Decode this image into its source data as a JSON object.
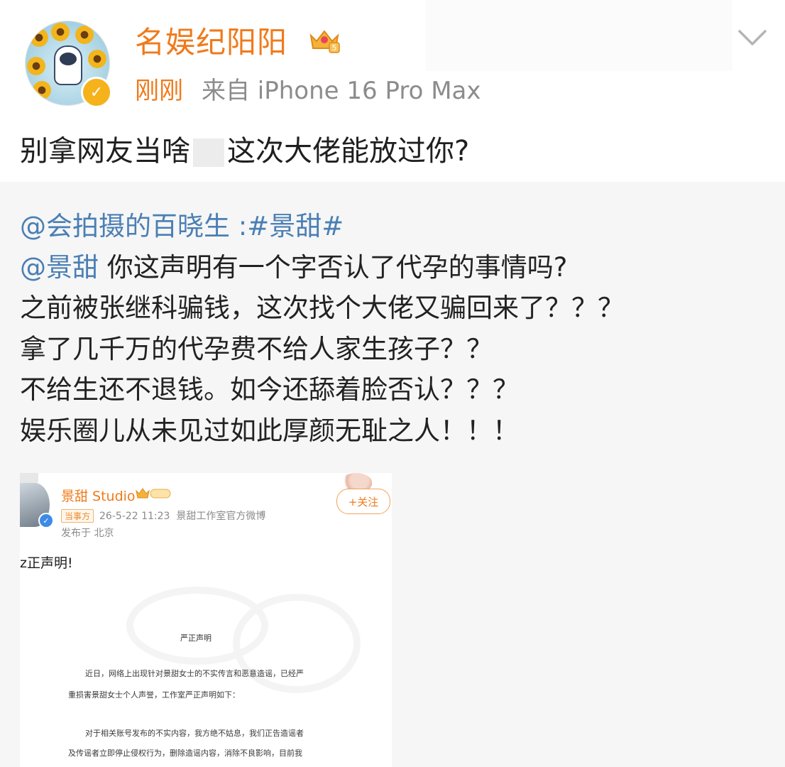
{
  "header": {
    "username": "名娱纪阳阳",
    "time": "刚刚",
    "device": "来自 iPhone 16 Pro Max",
    "verified_badge": "✓",
    "crown_level": "5"
  },
  "post": {
    "text_before": "别拿网友当啥",
    "text_after": "这次大佬能放过你?"
  },
  "repost": {
    "line1_mention": "@会拍摄的百晓生",
    "line1_rest": " :#景甜#",
    "line2_mention": "@景甜",
    "line2_rest": " 你这声明有一个字否认了代孕的事情吗?",
    "line3": "之前被张继科骗钱，这次找个大佬又骗回来了？？？",
    "line4": "拿了几千万的代孕费不给人家生孩子？？",
    "line5": "不给生还不退钱。如今还舔着脸否认？？？",
    "line6": "娱乐圈儿从未见过如此厚颜无耻之人！！！"
  },
  "embed": {
    "name": "景甜 Studio",
    "tag": "当事方",
    "date": "26-5-22 11:23",
    "source": "景甜工作室官方微博",
    "location": "发布于 北京",
    "follow_label": "+关注",
    "post_title": "z正声明!",
    "doc_title": "严正声明",
    "para1_line1": "近日，网络上出现针对景甜女士的不实传言和恶意造谣，已经严",
    "para1_line2": "重损害景甜女士个人声誉，工作室严正声明如下：",
    "para2_line1": "对于相关账号发布的不实内容，我方绝不姑息，我们正告造谣者",
    "para2_line2": "及传谣者立即停止侵权行为，删除造谣内容，消除不良影响，目前我"
  },
  "colors": {
    "accent": "#f07a1a",
    "link": "#4a7fb4",
    "repost_bg": "#f6f6f6",
    "meta_gray": "#8c8c8c"
  },
  "icons": {
    "expand": "chevron-down-icon",
    "crown": "crown-icon",
    "verified": "verified-icon"
  }
}
